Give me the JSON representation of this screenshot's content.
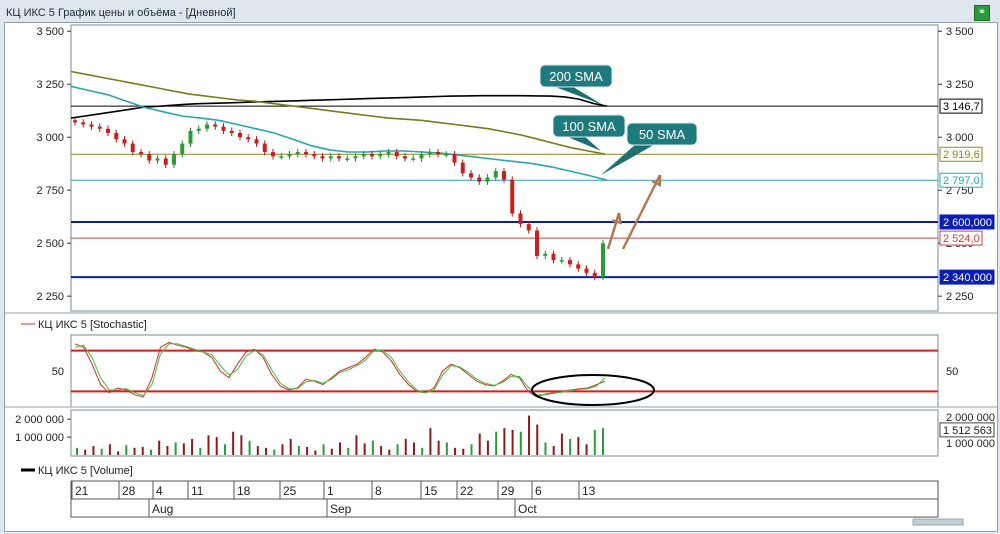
{
  "window": {
    "title": "КЦ ИКС 5 График цены и объёма - [Дневной]",
    "corner_icon": "link-icon"
  },
  "chart_data": [
    {
      "type": "candlestick",
      "yticks": [
        2250,
        2500,
        2750,
        3000,
        3250,
        3500
      ],
      "ytick_labels": [
        "2 250",
        "2 500",
        "2 750",
        "3 000",
        "3 250",
        "3 500"
      ],
      "ylim": [
        2180,
        3520
      ],
      "bars_count": 61,
      "closes": [
        3070,
        3060,
        3050,
        3040,
        3020,
        2990,
        2970,
        2930,
        2920,
        2890,
        2900,
        2870,
        2920,
        2970,
        3030,
        3040,
        3060,
        3050,
        3030,
        3020,
        3000,
        2990,
        2970,
        2930,
        2910,
        2910,
        2920,
        2930,
        2920,
        2910,
        2900,
        2910,
        2900,
        2900,
        2910,
        2920,
        2910,
        2920,
        2930,
        2910,
        2900,
        2900,
        2920,
        2930,
        2920,
        2920,
        2880,
        2830,
        2810,
        2790,
        2810,
        2840,
        2800,
        2640,
        2590,
        2560,
        2440,
        2450,
        2420,
        2420,
        2400,
        2380,
        2360,
        2340,
        2500
      ],
      "horizontal_levels": [
        {
          "value": 3146.7,
          "label": "3 146,7",
          "color": "#000000"
        },
        {
          "value": 2919.6,
          "label": "2 919,6",
          "color": "#8a8a1a"
        },
        {
          "value": 2797.0,
          "label": "2 797,0",
          "color": "#2aa6b0"
        },
        {
          "value": 2600.0,
          "label": "2 600,000",
          "color": "#0a1eb4"
        },
        {
          "value": 2524.0,
          "label": "2 524,0",
          "color": "#d04040"
        },
        {
          "value": 2340.0,
          "label": "2 340,000",
          "color": "#0a1eb4"
        }
      ],
      "moving_averages": [
        {
          "name": "200 SMA",
          "color": "#000000",
          "values": [
            3090,
            3100,
            3110,
            3120,
            3130,
            3140,
            3145,
            3150,
            3155,
            3158,
            3160,
            3162,
            3164,
            3166,
            3168,
            3170,
            3172,
            3174,
            3176,
            3178,
            3180,
            3182,
            3184,
            3186,
            3188,
            3190,
            3192,
            3194,
            3195,
            3196,
            3196,
            3196,
            3196,
            3195,
            3194,
            3190,
            3180,
            3160,
            3146.7
          ]
        },
        {
          "name": "100 SMA",
          "color": "#7a7a1a",
          "values": [
            3310,
            3295,
            3280,
            3265,
            3250,
            3235,
            3220,
            3205,
            3195,
            3185,
            3175,
            3170,
            3160,
            3150,
            3140,
            3130,
            3120,
            3110,
            3100,
            3090,
            3085,
            3080,
            3070,
            3060,
            3050,
            3040,
            3025,
            3010,
            2990,
            2970,
            2950,
            2935,
            2919.6
          ]
        },
        {
          "name": "50 SMA",
          "color": "#2aa6b0",
          "values": [
            3240,
            3220,
            3200,
            3170,
            3140,
            3120,
            3100,
            3090,
            3080,
            3060,
            3040,
            3020,
            2990,
            2960,
            2940,
            2930,
            2930,
            2935,
            2935,
            2930,
            2925,
            2915,
            2905,
            2895,
            2885,
            2875,
            2860,
            2840,
            2820,
            2797
          ]
        }
      ],
      "annotations": [
        "200 SMA",
        "100 SMA",
        "50 SMA"
      ]
    },
    {
      "type": "line",
      "legend": "КЦ ИКС 5 [Stochastic]",
      "yticks": [
        50
      ],
      "ytick_labels": [
        "50"
      ],
      "levels": [
        80,
        20
      ],
      "series": [
        {
          "color": "#d03030",
          "values": [
            90,
            85,
            60,
            30,
            18,
            25,
            22,
            15,
            12,
            40,
            85,
            92,
            88,
            85,
            80,
            78,
            70,
            50,
            40,
            60,
            78,
            82,
            70,
            45,
            28,
            22,
            25,
            38,
            35,
            30,
            40,
            50,
            55,
            60,
            70,
            82,
            78,
            65,
            45,
            30,
            20,
            18,
            25,
            50,
            60,
            55,
            45,
            35,
            30,
            28,
            35,
            45,
            40,
            20,
            12,
            16,
            18,
            20,
            22,
            24,
            25,
            30,
            35
          ]
        },
        {
          "color": "#40c040",
          "values": [
            85,
            88,
            70,
            40,
            22,
            22,
            24,
            18,
            14,
            30,
            75,
            90,
            90,
            86,
            82,
            78,
            74,
            58,
            44,
            52,
            72,
            80,
            74,
            52,
            32,
            24,
            24,
            34,
            36,
            32,
            38,
            48,
            52,
            58,
            66,
            80,
            80,
            70,
            50,
            34,
            22,
            18,
            22,
            44,
            58,
            56,
            48,
            38,
            32,
            29,
            33,
            42,
            42,
            26,
            15,
            15,
            17,
            19,
            21,
            23,
            24,
            28,
            40
          ]
        }
      ]
    },
    {
      "type": "bar",
      "legend": "КЦ ИКС 5 [Volume]",
      "yticks": [
        1000000,
        2000000
      ],
      "ytick_labels": [
        "1 000 000",
        "2 000 000"
      ],
      "right_labels": [
        "2 000 000",
        "1 512 563",
        "1 000 000"
      ],
      "last_value_label": "1 512 563",
      "values": [
        400000,
        300000,
        500000,
        350000,
        600000,
        200000,
        550000,
        400000,
        450000,
        300000,
        800000,
        500000,
        700000,
        650000,
        900000,
        400000,
        1100000,
        1000000,
        600000,
        1300000,
        1100000,
        800000,
        500000,
        400000,
        300000,
        600000,
        900000,
        500000,
        450000,
        250000,
        600000,
        350000,
        700000,
        400000,
        1100000,
        650000,
        800000,
        500000,
        300000,
        600000,
        900000,
        700000,
        400000,
        1500000,
        800000,
        700000,
        400000,
        350000,
        600000,
        1200000,
        800000,
        1300000,
        1500000,
        1400000,
        1300000,
        2200000,
        1700000,
        700000,
        500000,
        1200000,
        900000,
        1000000,
        600000,
        1400000,
        1500000
      ],
      "colors_up_down": [
        "#2e9b3a",
        "#8b1a1a"
      ]
    }
  ],
  "xaxis": {
    "day_ticks": [
      "21",
      "28",
      "4",
      "11",
      "18",
      "25",
      "1",
      "8",
      "15",
      "22",
      "29",
      "6",
      "13"
    ],
    "month_labels": [
      "Aug",
      "Sep",
      "Oct"
    ]
  }
}
